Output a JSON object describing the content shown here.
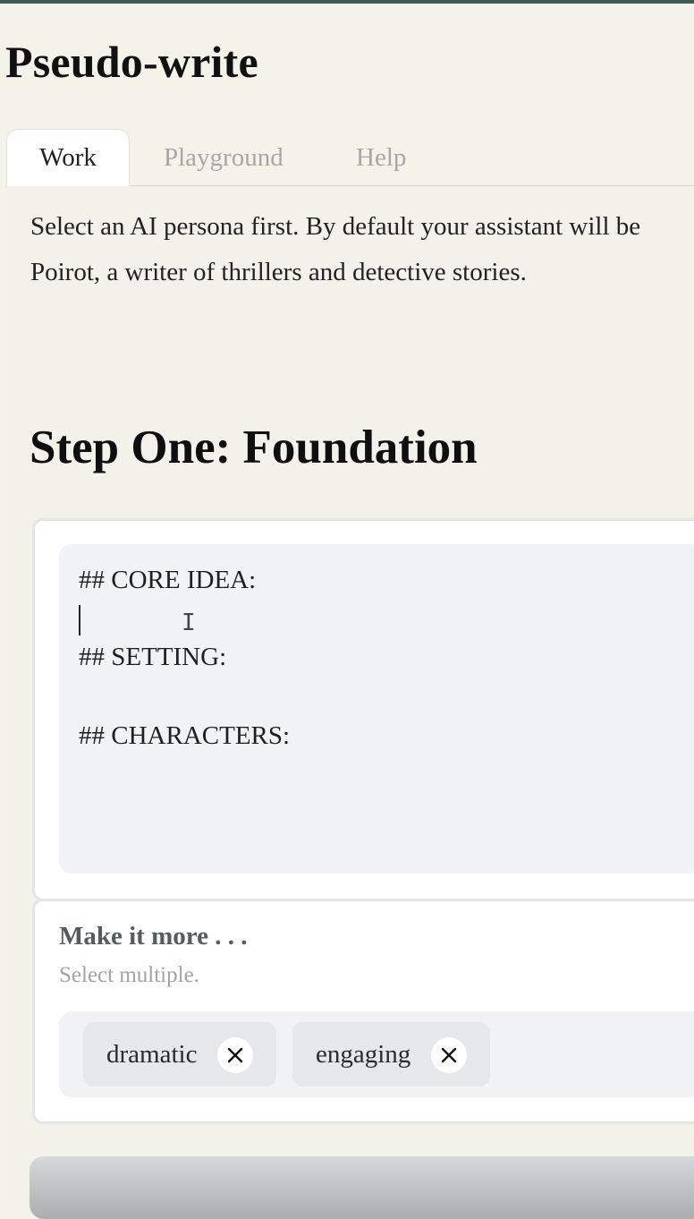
{
  "app": {
    "title": "Pseudo-write"
  },
  "tabs": [
    {
      "label": "Work",
      "active": true
    },
    {
      "label": "Playground",
      "active": false
    },
    {
      "label": "Help",
      "active": false
    }
  ],
  "work": {
    "intro_line_1": "Select an AI persona first. By default your assistant will be",
    "intro_line_2": "Poirot, a writer of thrillers and detective stories.",
    "step_heading": "Step One: Foundation",
    "editor": {
      "line_core_idea": "## CORE IDEA:",
      "line_setting": "## SETTING:",
      "line_characters": "## CHARACTERS:"
    },
    "modifiers": {
      "title": "Make it more . . .",
      "hint": "Select multiple.",
      "chips": [
        {
          "label": "dramatic",
          "remove_icon": "close-icon"
        },
        {
          "label": "engaging",
          "remove_icon": "close-icon"
        }
      ]
    }
  },
  "colors": {
    "page_background": "#f4f3ea",
    "card_background": "#ffffff",
    "editor_background": "#f1f2f3",
    "chip_background": "#e5e7ea",
    "muted_text": "#a7a7a7"
  }
}
